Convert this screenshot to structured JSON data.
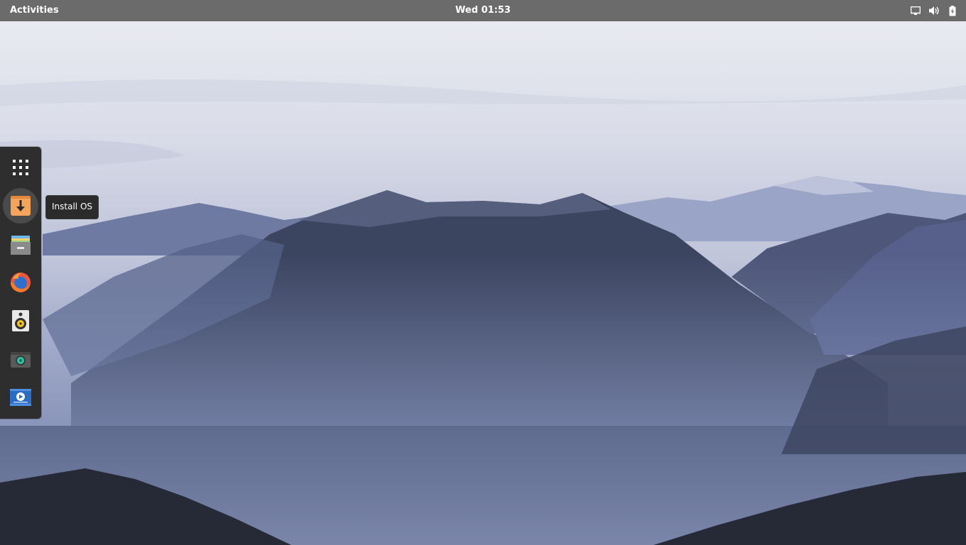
{
  "topbar": {
    "activities_label": "Activities",
    "clock": "Wed 01:53",
    "tray_icons": [
      "display-icon",
      "volume-icon",
      "battery-icon"
    ]
  },
  "dock": {
    "items": [
      {
        "name": "show-applications",
        "icon": "app-grid-icon"
      },
      {
        "name": "install-os",
        "icon": "installer-download-icon",
        "tooltip": "Install OS",
        "active": true
      },
      {
        "name": "files",
        "icon": "files-folder-icon"
      },
      {
        "name": "firefox",
        "icon": "firefox-icon"
      },
      {
        "name": "rhythmbox",
        "icon": "speaker-icon"
      },
      {
        "name": "cheese",
        "icon": "camera-icon"
      },
      {
        "name": "videos",
        "icon": "video-player-icon"
      }
    ]
  },
  "tooltip": {
    "text": "Install OS"
  },
  "colors": {
    "topbar_bg": "#6b6b6b",
    "dock_bg": "#2e2e2e",
    "installer_orange": "#f5a55b",
    "sky_light": "#e4e6ef",
    "mountain_dark": "#33394a"
  }
}
